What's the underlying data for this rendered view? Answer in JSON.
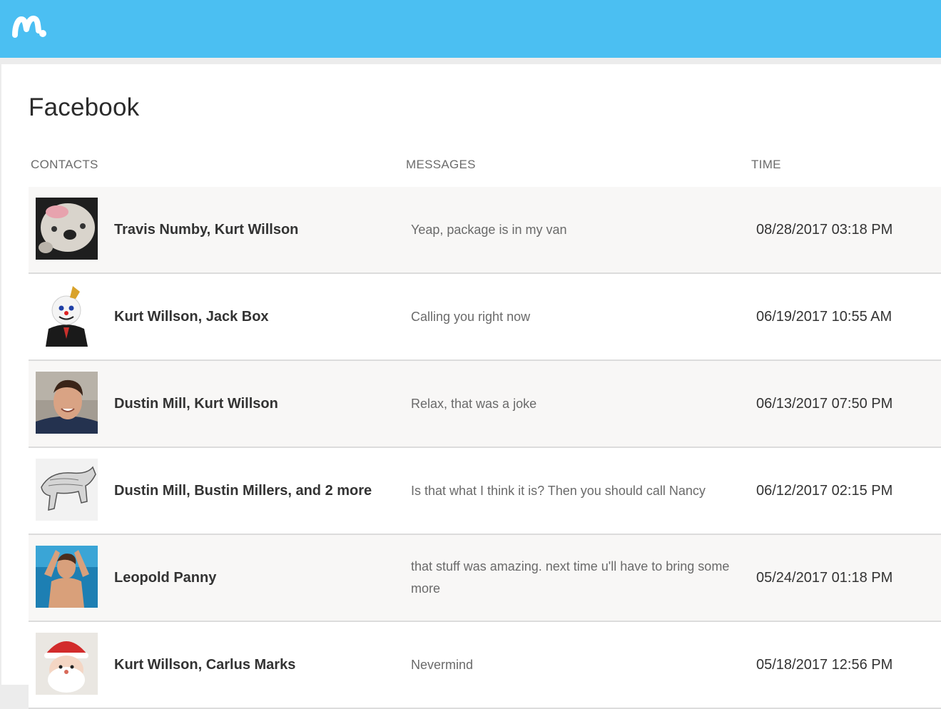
{
  "app": {
    "logo_icon": "mspy-logo-icon",
    "brand_color": "#4bbff2"
  },
  "page": {
    "title": "Facebook"
  },
  "columns": {
    "contacts": "CONTACTS",
    "messages": "MESSAGES",
    "time": "TIME"
  },
  "rows": [
    {
      "avatar": "bulldog-photo",
      "contacts": "Travis Numby, Kurt Willson",
      "message": "Yeap, package is in my van",
      "time": "08/28/2017 03:18 PM"
    },
    {
      "avatar": "jack-box-photo",
      "contacts": "Kurt Willson, Jack Box",
      "message": "Calling you right now",
      "time": "06/19/2017 10:55 AM"
    },
    {
      "avatar": "smiling-man-photo",
      "contacts": "Dustin Mill, Kurt Willson",
      "message": "Relax, that was a joke",
      "time": "06/13/2017 07:50 PM"
    },
    {
      "avatar": "rhino-sketch-photo",
      "contacts": "Dustin Mill, Bustin Millers, and 2 more",
      "message": "Is that what I think it is? Then you should call Nancy",
      "time": "06/12/2017 02:15 PM"
    },
    {
      "avatar": "shirtless-man-photo",
      "contacts": "Leopold Panny",
      "message": "that stuff was amazing. next time u'll have to bring some more",
      "time": "05/24/2017 01:18 PM"
    },
    {
      "avatar": "santa-toy-photo",
      "contacts": "Kurt Willson, Carlus Marks",
      "message": "Nevermind",
      "time": "05/18/2017 12:56 PM"
    }
  ]
}
